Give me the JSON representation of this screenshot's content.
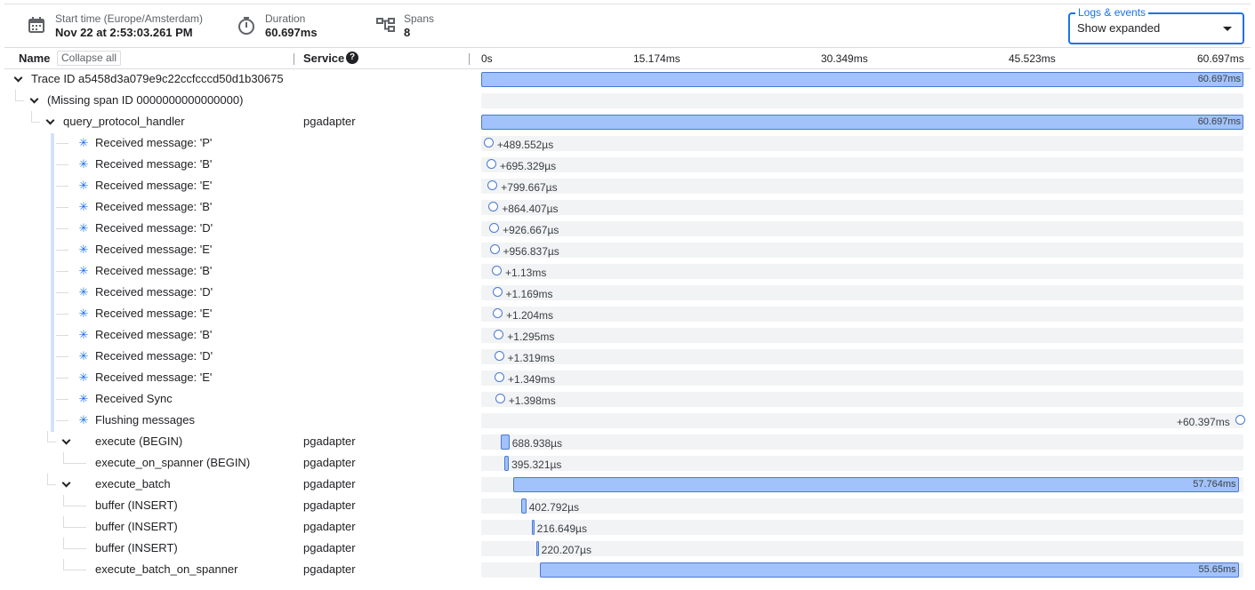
{
  "header": {
    "start_label": "Start time (Europe/Amsterdam)",
    "start_value": "Nov 22 at 2:53:03.261 PM",
    "duration_label": "Duration",
    "duration_value": "60.697ms",
    "spans_label": "Spans",
    "spans_value": "8",
    "logs_label": "Logs & events",
    "logs_value": "Show expanded",
    "icons": [
      "calendar-icon",
      "stopwatch-icon",
      "spans-tree-icon",
      "chevron-down-icon"
    ]
  },
  "columns": {
    "name": "Name",
    "collapse": "Collapse all",
    "service": "Service",
    "ticks": [
      "0s",
      "15.174ms",
      "30.349ms",
      "45.523ms",
      "60.697ms"
    ]
  },
  "total_ms": 60.697,
  "rows": [
    {
      "name": "Trace ID a5458d3a079e9c22ccfcccd50d1b30675",
      "indent": 0,
      "chevron": true,
      "service": "",
      "kind": "bar",
      "start_ms": 0,
      "dur_ms": 60.697,
      "label": "60.697ms"
    },
    {
      "name": "(Missing span ID 0000000000000000)",
      "indent": 1,
      "chevron": true,
      "service": "",
      "kind": "empty"
    },
    {
      "name": "query_protocol_handler",
      "indent": 2,
      "chevron": true,
      "service": "pgadapter",
      "kind": "bar",
      "start_ms": 0,
      "dur_ms": 60.697,
      "label": "60.697ms"
    },
    {
      "name": "Received message: 'P'",
      "indent": 3,
      "event": true,
      "service": "",
      "kind": "event",
      "at_ms": 0.4896,
      "label": "+489.552µs"
    },
    {
      "name": "Received message: 'B'",
      "indent": 3,
      "event": true,
      "service": "",
      "kind": "event",
      "at_ms": 0.6953,
      "label": "+695.329µs"
    },
    {
      "name": "Received message: 'E'",
      "indent": 3,
      "event": true,
      "service": "",
      "kind": "event",
      "at_ms": 0.7997,
      "label": "+799.667µs"
    },
    {
      "name": "Received message: 'B'",
      "indent": 3,
      "event": true,
      "service": "",
      "kind": "event",
      "at_ms": 0.8644,
      "label": "+864.407µs"
    },
    {
      "name": "Received message: 'D'",
      "indent": 3,
      "event": true,
      "service": "",
      "kind": "event",
      "at_ms": 0.9267,
      "label": "+926.667µs"
    },
    {
      "name": "Received message: 'E'",
      "indent": 3,
      "event": true,
      "service": "",
      "kind": "event",
      "at_ms": 0.9568,
      "label": "+956.837µs"
    },
    {
      "name": "Received message: 'B'",
      "indent": 3,
      "event": true,
      "service": "",
      "kind": "event",
      "at_ms": 1.13,
      "label": "+1.13ms"
    },
    {
      "name": "Received message: 'D'",
      "indent": 3,
      "event": true,
      "service": "",
      "kind": "event",
      "at_ms": 1.169,
      "label": "+1.169ms"
    },
    {
      "name": "Received message: 'E'",
      "indent": 3,
      "event": true,
      "service": "",
      "kind": "event",
      "at_ms": 1.204,
      "label": "+1.204ms"
    },
    {
      "name": "Received message: 'B'",
      "indent": 3,
      "event": true,
      "service": "",
      "kind": "event",
      "at_ms": 1.295,
      "label": "+1.295ms"
    },
    {
      "name": "Received message: 'D'",
      "indent": 3,
      "event": true,
      "service": "",
      "kind": "event",
      "at_ms": 1.319,
      "label": "+1.319ms"
    },
    {
      "name": "Received message: 'E'",
      "indent": 3,
      "event": true,
      "service": "",
      "kind": "event",
      "at_ms": 1.349,
      "label": "+1.349ms"
    },
    {
      "name": "Received Sync",
      "indent": 3,
      "event": true,
      "service": "",
      "kind": "event",
      "at_ms": 1.398,
      "label": "+1.398ms"
    },
    {
      "name": "Flushing messages",
      "indent": 3,
      "event": true,
      "service": "",
      "kind": "event_end",
      "at_ms": 60.397,
      "label": "+60.397ms"
    },
    {
      "name": "execute (BEGIN)",
      "indent": 3,
      "chevron": true,
      "service": "pgadapter",
      "kind": "bar",
      "start_ms": 1.56,
      "dur_ms": 0.688938,
      "label": "688.938µs",
      "label_outside": true
    },
    {
      "name": "execute_on_spanner (BEGIN)",
      "indent": 4,
      "service": "pgadapter",
      "kind": "bar",
      "start_ms": 1.81,
      "dur_ms": 0.395321,
      "label": "395.321µs",
      "label_outside": true
    },
    {
      "name": "execute_batch",
      "indent": 3,
      "chevron": true,
      "service": "pgadapter",
      "kind": "bar",
      "start_ms": 2.546,
      "dur_ms": 57.764,
      "label": "57.764ms"
    },
    {
      "name": "buffer (INSERT)",
      "indent": 4,
      "service": "pgadapter",
      "kind": "bar",
      "start_ms": 3.19,
      "dur_ms": 0.402792,
      "label": "402.792µs",
      "label_outside": true
    },
    {
      "name": "buffer (INSERT)",
      "indent": 4,
      "service": "pgadapter",
      "kind": "bar",
      "start_ms": 4.01,
      "dur_ms": 0.216649,
      "label": "216.649µs",
      "label_outside": true
    },
    {
      "name": "buffer (INSERT)",
      "indent": 4,
      "service": "pgadapter",
      "kind": "bar",
      "start_ms": 4.36,
      "dur_ms": 0.220207,
      "label": "220.207µs",
      "label_outside": true
    },
    {
      "name": "execute_batch_on_spanner",
      "indent": 4,
      "service": "pgadapter",
      "kind": "bar",
      "start_ms": 4.67,
      "dur_ms": 55.65,
      "label": "55.65ms"
    }
  ]
}
